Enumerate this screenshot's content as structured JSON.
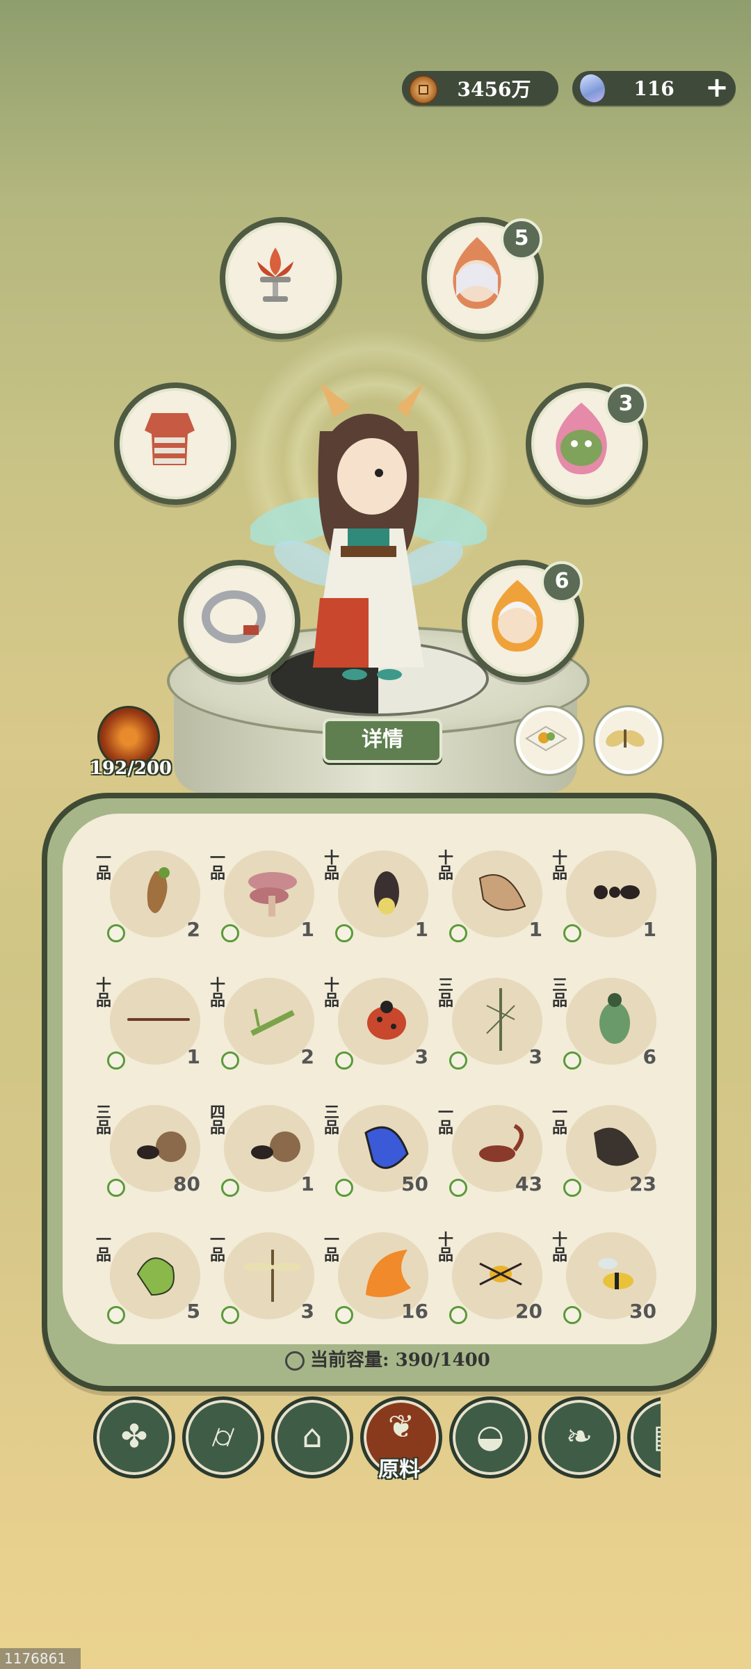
{
  "currency": {
    "coins": "3456万",
    "gems": "116",
    "add_symbol": "+"
  },
  "equipment": {
    "slots": [
      {
        "name": "lotus-lamp",
        "badge": ""
      },
      {
        "name": "spirit-fire-elder",
        "badge": "5"
      },
      {
        "name": "armor",
        "badge": ""
      },
      {
        "name": "dragon-beast",
        "badge": "3"
      },
      {
        "name": "ring",
        "badge": ""
      },
      {
        "name": "fire-spirit-boy",
        "badge": "6"
      }
    ]
  },
  "level_text": "192/200",
  "detail_button": "详情",
  "inventory": {
    "items": [
      {
        "grade": "一品",
        "count": "2",
        "icon": "ginseng-root"
      },
      {
        "grade": "一品",
        "count": "1",
        "icon": "lingzhi-mushroom"
      },
      {
        "grade": "十品",
        "count": "1",
        "icon": "firefly"
      },
      {
        "grade": "十品",
        "count": "1",
        "icon": "brown-wing"
      },
      {
        "grade": "十品",
        "count": "1",
        "icon": "ant"
      },
      {
        "grade": "十品",
        "count": "1",
        "icon": "twig"
      },
      {
        "grade": "十品",
        "count": "2",
        "icon": "mantis"
      },
      {
        "grade": "十品",
        "count": "3",
        "icon": "ladybug"
      },
      {
        "grade": "三品",
        "count": "3",
        "icon": "stick-insect"
      },
      {
        "grade": "三品",
        "count": "6",
        "icon": "green-beetle"
      },
      {
        "grade": "三品",
        "count": "80",
        "icon": "dung-beetle"
      },
      {
        "grade": "四品",
        "count": "1",
        "icon": "dung-beetle"
      },
      {
        "grade": "三品",
        "count": "50",
        "icon": "blue-butterfly-wing"
      },
      {
        "grade": "一品",
        "count": "43",
        "icon": "scorpion"
      },
      {
        "grade": "一品",
        "count": "23",
        "icon": "dark-moth-wing"
      },
      {
        "grade": "一品",
        "count": "5",
        "icon": "green-butterfly-wing"
      },
      {
        "grade": "一品",
        "count": "3",
        "icon": "dragonfly"
      },
      {
        "grade": "一品",
        "count": "16",
        "icon": "flame-wing"
      },
      {
        "grade": "十品",
        "count": "20",
        "icon": "golden-spider"
      },
      {
        "grade": "十品",
        "count": "30",
        "icon": "wasp"
      }
    ]
  },
  "capacity": "当前容量: 390/1400",
  "nav": {
    "active_label": "原料",
    "items": [
      "grid-menu-icon",
      "log-icon",
      "house-icon",
      "herb-icon",
      "rice-bowl-icon",
      "ginseng-icon",
      "scroll-icon"
    ]
  },
  "footer_id": "1176861"
}
